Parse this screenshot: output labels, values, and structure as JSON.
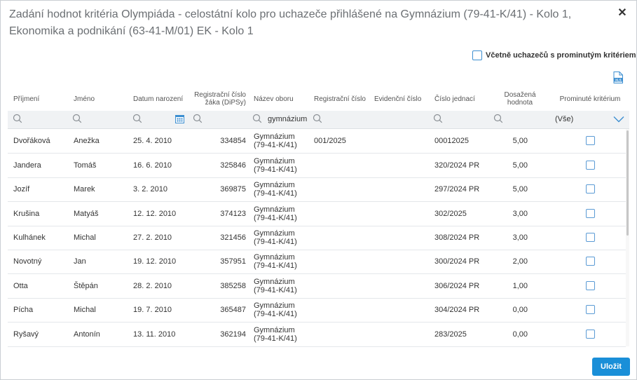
{
  "dialog": {
    "title": "Zadání hodnot kritéria Olympiáda - celostátní kolo pro uchazeče přihlášené na Gymnázium (79-41-K/41) - Kolo 1, Ekonomika a podnikání (63-41-M/01) EK - Kolo 1",
    "close_icon": "close-icon"
  },
  "options": {
    "include_waived_label": "Včetně uchazečů s prominutým kritériem",
    "include_waived_checked": false
  },
  "export": {
    "icon": "xls-export-icon",
    "label": "XLS"
  },
  "columns": [
    {
      "key": "prijmeni",
      "label": "Příjmení"
    },
    {
      "key": "jmeno",
      "label": "Jméno"
    },
    {
      "key": "datum",
      "label": "Datum narození"
    },
    {
      "key": "dipsy",
      "label": "Registrační číslo žáka (DiPSy)"
    },
    {
      "key": "obor",
      "label": "Název oboru"
    },
    {
      "key": "reg",
      "label": "Registrační číslo"
    },
    {
      "key": "evid",
      "label": "Evidenční číslo"
    },
    {
      "key": "cj",
      "label": "Číslo jednací"
    },
    {
      "key": "hodnota",
      "label": "Dosažená hodnota"
    },
    {
      "key": "prominute",
      "label": "Prominuté kritérium"
    }
  ],
  "filters": {
    "obor_value": "gymnázium",
    "prominute_value": "(Vše)"
  },
  "rows": [
    {
      "prijmeni": "Dvořáková",
      "jmeno": "Anežka",
      "datum": "25. 4. 2010",
      "dipsy": "334854",
      "obor_1": "Gymnázium",
      "obor_2": "(79-41-K/41)",
      "reg": "001/2025",
      "evid": "",
      "cj": "00012025",
      "hodnota": "5,00",
      "prominute": false
    },
    {
      "prijmeni": "Jandera",
      "jmeno": "Tomáš",
      "datum": "16. 6. 2010",
      "dipsy": "325846",
      "obor_1": "Gymnázium",
      "obor_2": "(79-41-K/41)",
      "reg": "",
      "evid": "",
      "cj": "320/2024 PR",
      "hodnota": "5,00",
      "prominute": false
    },
    {
      "prijmeni": "Jozíf",
      "jmeno": "Marek",
      "datum": "3. 2. 2010",
      "dipsy": "369875",
      "obor_1": "Gymnázium",
      "obor_2": "(79-41-K/41)",
      "reg": "",
      "evid": "",
      "cj": "297/2024 PR",
      "hodnota": "5,00",
      "prominute": false
    },
    {
      "prijmeni": "Krušina",
      "jmeno": "Matyáš",
      "datum": "12. 12. 2010",
      "dipsy": "374123",
      "obor_1": "Gymnázium",
      "obor_2": "(79-41-K/41)",
      "reg": "",
      "evid": "",
      "cj": "302/2025",
      "hodnota": "3,00",
      "prominute": false
    },
    {
      "prijmeni": "Kulhánek",
      "jmeno": "Michal",
      "datum": "27. 2. 2010",
      "dipsy": "321456",
      "obor_1": "Gymnázium",
      "obor_2": "(79-41-K/41)",
      "reg": "",
      "evid": "",
      "cj": "308/2024 PR",
      "hodnota": "3,00",
      "prominute": false
    },
    {
      "prijmeni": "Novotný",
      "jmeno": "Jan",
      "datum": "19. 12. 2010",
      "dipsy": "357951",
      "obor_1": "Gymnázium",
      "obor_2": "(79-41-K/41)",
      "reg": "",
      "evid": "",
      "cj": "300/2024 PR",
      "hodnota": "2,00",
      "prominute": false
    },
    {
      "prijmeni": "Otta",
      "jmeno": "Štěpán",
      "datum": "28. 2. 2010",
      "dipsy": "385258",
      "obor_1": "Gymnázium",
      "obor_2": "(79-41-K/41)",
      "reg": "",
      "evid": "",
      "cj": "306/2024 PR",
      "hodnota": "1,00",
      "prominute": false
    },
    {
      "prijmeni": "Pícha",
      "jmeno": "Michal",
      "datum": "19. 7. 2010",
      "dipsy": "365487",
      "obor_1": "Gymnázium",
      "obor_2": "(79-41-K/41)",
      "reg": "",
      "evid": "",
      "cj": "304/2024 PR",
      "hodnota": "0,00",
      "prominute": false
    },
    {
      "prijmeni": "Ryšavý",
      "jmeno": "Antonín",
      "datum": "13. 11. 2010",
      "dipsy": "362194",
      "obor_1": "Gymnázium",
      "obor_2": "(79-41-K/41)",
      "reg": "",
      "evid": "",
      "cj": "283/2025",
      "hodnota": "0,00",
      "prominute": false
    }
  ],
  "footer": {
    "save_label": "Uložit"
  },
  "colors": {
    "accent": "#1a8fd8",
    "checkbox_border": "#5b9bd5",
    "filter_bg": "#f0f2f4"
  }
}
